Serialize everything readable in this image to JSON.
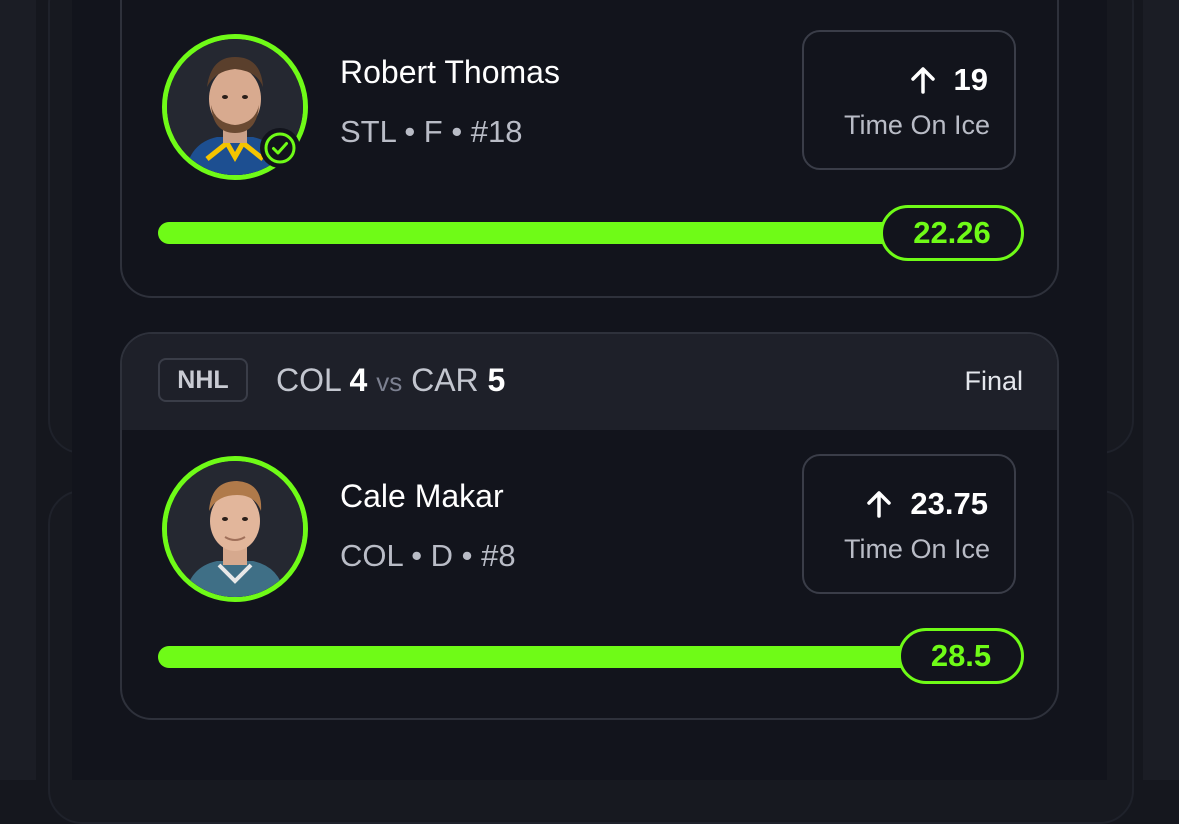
{
  "colors": {
    "accent": "#6ffb17",
    "background": "#12141c",
    "card_border": "#2e313b",
    "header_bg": "#1e2029"
  },
  "cards": [
    {
      "player": {
        "name": "Robert Thomas",
        "team": "STL",
        "position": "F",
        "number": "#18",
        "meta": "STL • F • #18",
        "verified": true
      },
      "stat": {
        "icon": "arrow-up-icon",
        "value": "19",
        "label": "Time On Ice"
      },
      "progress": {
        "value": "22.26",
        "fill_fraction": 1.0
      }
    },
    {
      "game": {
        "league": "NHL",
        "away_team": "COL",
        "away_score": "4",
        "vs": "vs",
        "home_team": "CAR",
        "home_score": "5",
        "status": "Final"
      },
      "player": {
        "name": "Cale Makar",
        "team": "COL",
        "position": "D",
        "number": "#8",
        "meta": "COL • D • #8",
        "verified": false
      },
      "stat": {
        "icon": "arrow-up-icon",
        "value": "23.75",
        "label": "Time On Ice"
      },
      "progress": {
        "value": "28.5",
        "fill_fraction": 1.0
      }
    }
  ]
}
